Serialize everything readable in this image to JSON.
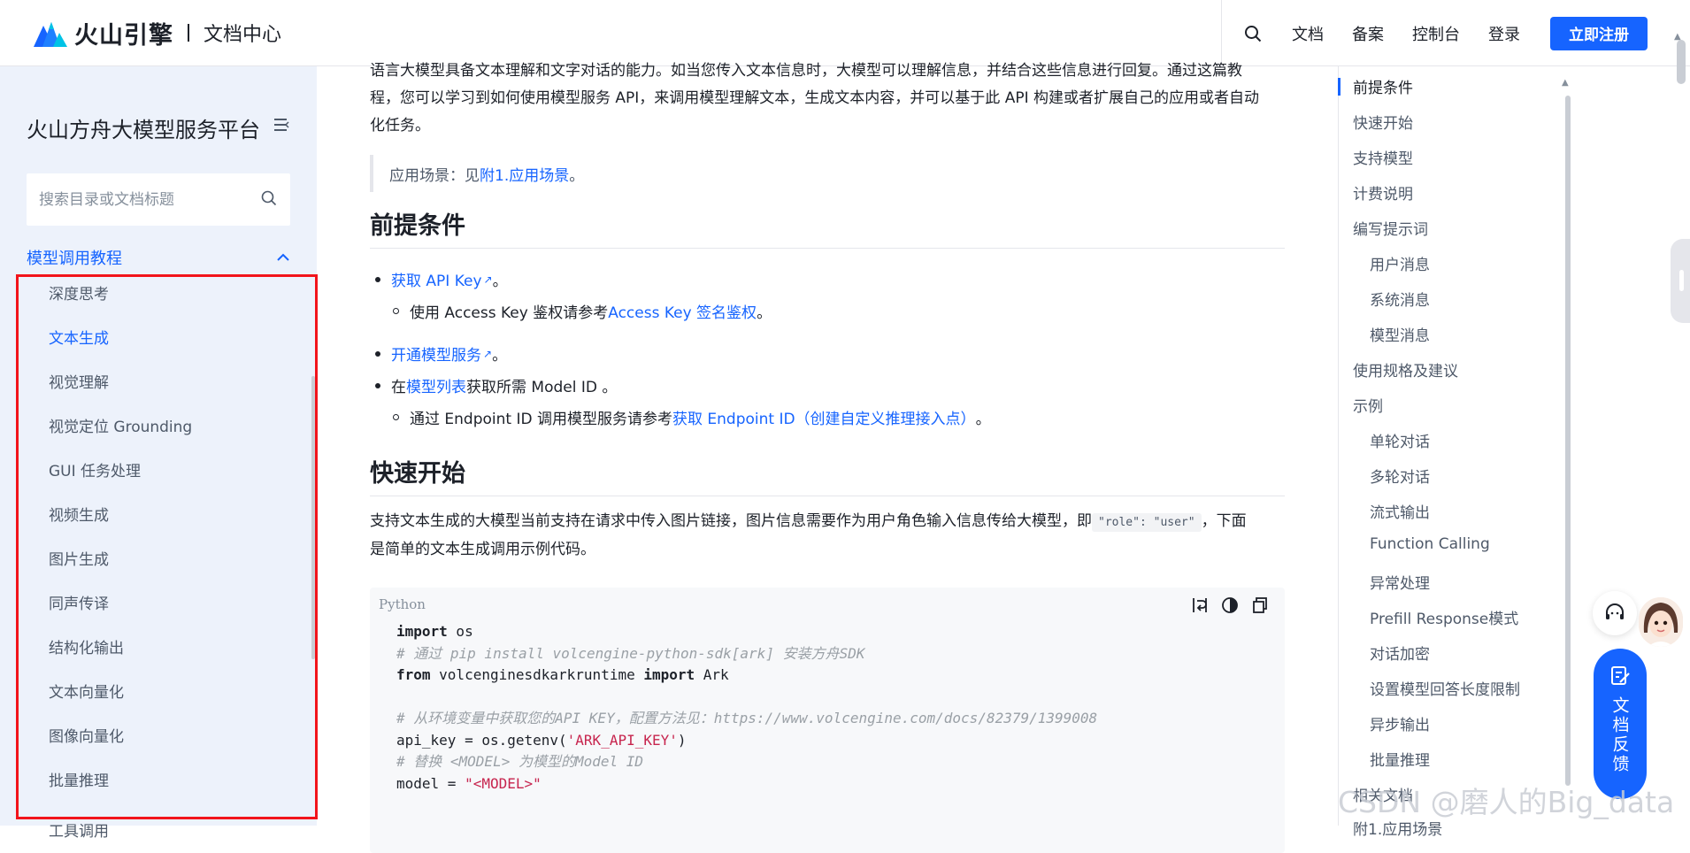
{
  "header": {
    "brand": "火山引擎",
    "section": "文档中心",
    "links": [
      "文档",
      "备案",
      "控制台",
      "登录"
    ],
    "signup": "立即注册"
  },
  "sidebar": {
    "title": "火山方舟大模型服务平台",
    "search_placeholder": "搜索目录或文档标题",
    "section": "模型调用教程",
    "items": [
      {
        "label": "深度思考",
        "active": false
      },
      {
        "label": "文本生成",
        "active": true
      },
      {
        "label": "视觉理解",
        "active": false
      },
      {
        "label": "视觉定位 Grounding",
        "active": false
      },
      {
        "label": "GUI 任务处理",
        "active": false
      },
      {
        "label": "视频生成",
        "active": false
      },
      {
        "label": "图片生成",
        "active": false
      },
      {
        "label": "同声传译",
        "active": false
      },
      {
        "label": "结构化输出",
        "active": false
      },
      {
        "label": "文本向量化",
        "active": false
      },
      {
        "label": "图像向量化",
        "active": false
      },
      {
        "label": "批量推理",
        "active": false
      }
    ],
    "cut_item": "工具调用"
  },
  "content": {
    "intro_line1": "语言大模型具备文本理解和文字对话的能力。如当您传入文本信息时，大模型可以理解信息，并结合这些信息进行回复。通过这篇教",
    "intro_line2": "程，您可以学习到如何使用模型服务 API，来调用模型理解文本，生成文本内容，并可以基于此 API 构建或者扩展自己的应用或者自动",
    "intro_line3": "化任务。",
    "quote_prefix": "应用场景：见 ",
    "quote_link": "附1.应用场景",
    "quote_suffix": "。",
    "h_prereq": "前提条件",
    "b1_link": "获取 API Key",
    "b1_suffix": " 。",
    "b1_sub_prefix": "使用 Access Key 鉴权请参考",
    "b1_sub_link": "Access Key 签名鉴权",
    "b1_sub_suffix": "。",
    "b2_link": "开通模型服务",
    "b2_suffix": "。",
    "b3_prefix": "在",
    "b3_link": "模型列表",
    "b3_suffix": "获取所需 Model ID 。",
    "b3_sub_prefix": "通过 Endpoint ID 调用模型服务请参考",
    "b3_sub_link": "获取 Endpoint ID（创建自定义推理接入点）",
    "b3_sub_suffix": " 。",
    "h_quick": "快速开始",
    "quick_p1": "支持文本生成的大模型当前支持在请求中传入图片链接，图片信息需要作为用户角色输入信息传给大模型，即",
    "quick_code": "\"role\": \"user\"",
    "quick_p2": "，下面",
    "quick_p3": "是简单的文本生成调用示例代码。",
    "code_lang": "Python",
    "code": {
      "l1_kw": "import",
      "l1_tx": " os",
      "l2": "# 通过 pip install volcengine-python-sdk[ark] 安装方舟SDK",
      "l3_kw1": "from",
      "l3_tx": " volcenginesdkarkruntime ",
      "l3_kw2": "import",
      "l3_tx2": " Ark",
      "l5": "# 从环境变量中获取您的API KEY，配置方法见：https://www.volcengine.com/docs/82379/1399008",
      "l6_tx": "api_key = os.getenv(",
      "l6_st": "'ARK_API_KEY'",
      "l6_end": ")",
      "l7": "# 替换 <MODEL> 为模型的Model ID",
      "l8_tx": "model = ",
      "l8_st": "\"<MODEL>\""
    }
  },
  "toc": {
    "items": [
      {
        "label": "前提条件",
        "level": 1,
        "active": true
      },
      {
        "label": "快速开始",
        "level": 1
      },
      {
        "label": "支持模型",
        "level": 1
      },
      {
        "label": "计费说明",
        "level": 1
      },
      {
        "label": "编写提示词",
        "level": 1
      },
      {
        "label": "用户消息",
        "level": 2
      },
      {
        "label": "系统消息",
        "level": 2
      },
      {
        "label": "模型消息",
        "level": 2
      },
      {
        "label": "使用规格及建议",
        "level": 1
      },
      {
        "label": "示例",
        "level": 1
      },
      {
        "label": "单轮对话",
        "level": 2
      },
      {
        "label": "多轮对话",
        "level": 2
      },
      {
        "label": "流式输出",
        "level": 2
      },
      {
        "label": "Function Calling",
        "level": 2
      },
      {
        "label": "异常处理",
        "level": 2
      },
      {
        "label": "Prefill Response模式",
        "level": 2
      },
      {
        "label": "对话加密",
        "level": 2
      },
      {
        "label": "设置模型回答长度限制",
        "level": 2
      },
      {
        "label": "异步输出",
        "level": 2
      },
      {
        "label": "批量推理",
        "level": 2
      },
      {
        "label": "相关文档",
        "level": 1
      },
      {
        "label": "附1.应用场景",
        "level": 1
      }
    ]
  },
  "feedback": {
    "label": "文档反馈"
  },
  "watermark": "CSDN @磨人的Big_data",
  "colors": {
    "accent": "#1664ff",
    "sidebar_bg": "#edf2fb",
    "highlight_box": "#f2141b"
  }
}
